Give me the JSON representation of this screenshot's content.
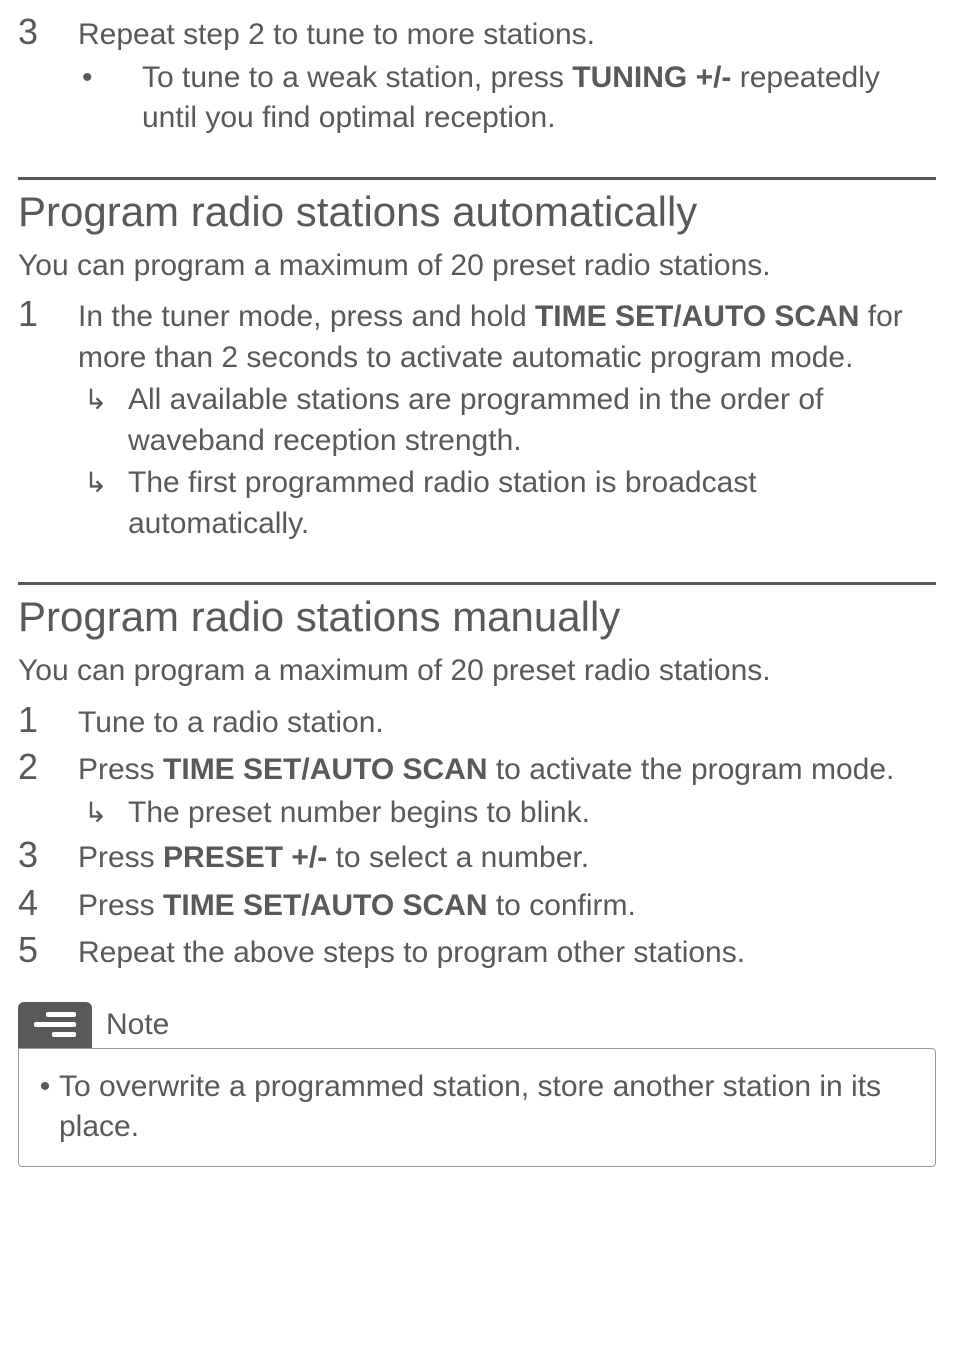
{
  "step3": {
    "num": "3",
    "text_a": "Repeat step 2 to tune to more stations.",
    "bullet_a_pre": "To tune to a weak station, press ",
    "bullet_a_bold": "TUNING +/-",
    "bullet_a_post": " repeatedly until you find optimal reception."
  },
  "section_auto": {
    "heading": "Program radio stations automatically",
    "intro": "You can program a maximum of 20 preset radio stations.",
    "step1_num": "1",
    "step1_pre": "In the tuner mode, press and hold ",
    "step1_bold": "TIME SET/AUTO SCAN",
    "step1_post": " for more than 2 seconds to activate automatic program mode.",
    "result1": "All available stations are programmed in the order of waveband reception strength.",
    "result2": "The first programmed radio station is broadcast automatically."
  },
  "section_manual": {
    "heading": "Program radio stations manually",
    "intro": "You can program a maximum of 20 preset radio stations.",
    "s1_num": "1",
    "s1_text": "Tune to a radio station.",
    "s2_num": "2",
    "s2_pre": "Press ",
    "s2_bold": "TIME SET/AUTO SCAN",
    "s2_post": " to activate the program mode.",
    "s2_result": "The preset number begins to blink.",
    "s3_num": "3",
    "s3_pre": "Press ",
    "s3_bold": "PRESET +/-",
    "s3_post": " to select a number.",
    "s4_num": "4",
    "s4_pre": "Press ",
    "s4_bold": "TIME SET/AUTO SCAN",
    "s4_post": " to confirm.",
    "s5_num": "5",
    "s5_text": "Repeat the above steps to program other stations."
  },
  "note": {
    "label": "Note",
    "text": "To overwrite a programmed station, store another station in its place."
  },
  "glyphs": {
    "bullet": "•",
    "arrow": "↳"
  }
}
